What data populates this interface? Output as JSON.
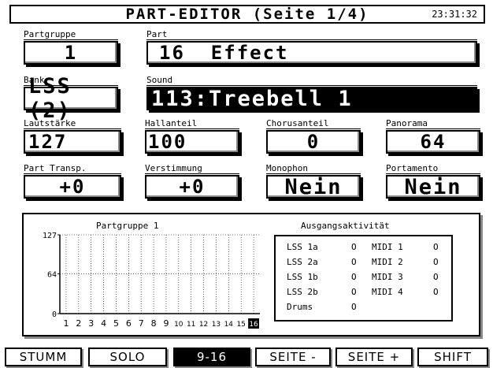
{
  "header": {
    "title": "PART-EDITOR (Seite 1/4)",
    "clock": "23:31:32"
  },
  "fields": {
    "partgruppe": {
      "label": "Partgruppe",
      "value": "1"
    },
    "part": {
      "label": "Part",
      "value": "16  Effect"
    },
    "bank": {
      "label": "Bank",
      "value": "LSS (2)"
    },
    "sound": {
      "label": "Sound",
      "value": "113:Treebell 1"
    },
    "lautstaerke": {
      "label": "Lautstärke",
      "value": "127"
    },
    "hallanteil": {
      "label": "Hallanteil",
      "value": "100"
    },
    "chorusanteil": {
      "label": "Chorusanteil",
      "value": "0"
    },
    "panorama": {
      "label": "Panorama",
      "value": "64"
    },
    "part_transp": {
      "label": "Part Transp.",
      "value": "+0"
    },
    "verstimmung": {
      "label": "Verstimmung",
      "value": "+0"
    },
    "monophon": {
      "label": "Monophon",
      "value": "Nein"
    },
    "portamento": {
      "label": "Portamento",
      "value": "Nein"
    }
  },
  "chart_data": {
    "type": "bar",
    "title": "Partgruppe 1",
    "categories": [
      "1",
      "2",
      "3",
      "4",
      "5",
      "6",
      "7",
      "8",
      "9",
      "10",
      "11",
      "12",
      "13",
      "14",
      "15",
      "16"
    ],
    "values": [
      0,
      0,
      0,
      0,
      0,
      0,
      0,
      0,
      0,
      0,
      0,
      0,
      0,
      0,
      0,
      0
    ],
    "y_ticks": [
      "127",
      "64",
      "0"
    ],
    "ylim": [
      0,
      127
    ],
    "selected_category": "16",
    "grid": true
  },
  "outputs": {
    "title": "Ausgangsaktivität",
    "left": [
      {
        "name": "LSS 1a",
        "state": "O"
      },
      {
        "name": "LSS 2a",
        "state": "O"
      },
      {
        "name": "LSS 1b",
        "state": "O"
      },
      {
        "name": "LSS 2b",
        "state": "O"
      },
      {
        "name": "Drums",
        "state": "O"
      }
    ],
    "right": [
      {
        "name": "MIDI 1",
        "state": "O"
      },
      {
        "name": "MIDI 2",
        "state": "O"
      },
      {
        "name": "MIDI 3",
        "state": "O"
      },
      {
        "name": "MIDI 4",
        "state": "O"
      }
    ]
  },
  "softkeys": [
    {
      "label": "STUMM",
      "active": false
    },
    {
      "label": "SOLO",
      "active": false
    },
    {
      "label": "9-16",
      "active": true
    },
    {
      "label": "SEITE -",
      "active": false
    },
    {
      "label": "SEITE +",
      "active": false
    },
    {
      "label": "SHIFT",
      "active": false
    }
  ]
}
